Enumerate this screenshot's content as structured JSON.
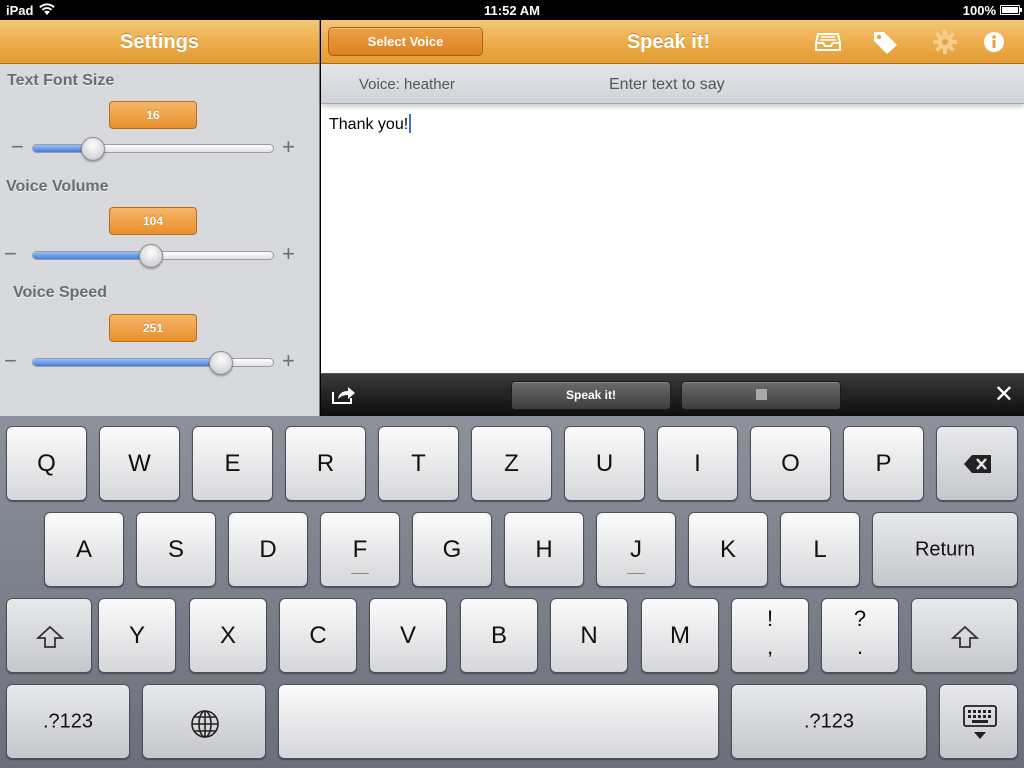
{
  "status_bar": {
    "device": "iPad",
    "time": "11:52 AM",
    "battery": "100%"
  },
  "sidebar": {
    "title": "Settings",
    "settings": [
      {
        "label": "Text Font Size",
        "value": "16",
        "fraction": 0.25
      },
      {
        "label": "Voice Volume",
        "value": "104",
        "fraction": 0.49
      },
      {
        "label": "Voice Speed",
        "value": "251",
        "fraction": 0.78
      }
    ],
    "minus": "−",
    "plus": "+"
  },
  "main": {
    "select_voice": "Select Voice",
    "title": "Speak it!",
    "voice": "Voice: heather",
    "prompt": "Enter text to say",
    "text": "Thank you!"
  },
  "accessory": {
    "speak": "Speak it!",
    "close": "✕"
  },
  "keyboard": {
    "row1": [
      "Q",
      "W",
      "E",
      "R",
      "T",
      "Z",
      "U",
      "I",
      "O",
      "P"
    ],
    "row2": [
      "A",
      "S",
      "D",
      "F",
      "G",
      "H",
      "J",
      "K",
      "L"
    ],
    "return": "Return",
    "row3": [
      "Y",
      "X",
      "C",
      "V",
      "B",
      "N",
      "M"
    ],
    "excl_top": "!",
    "excl_bottom": ",",
    "quest_top": "?",
    "quest_bottom": ".",
    "numbers": ".?123"
  },
  "colors": {
    "accent_orange": "#eeae4c",
    "slider_blue": "#3f7ee0"
  }
}
